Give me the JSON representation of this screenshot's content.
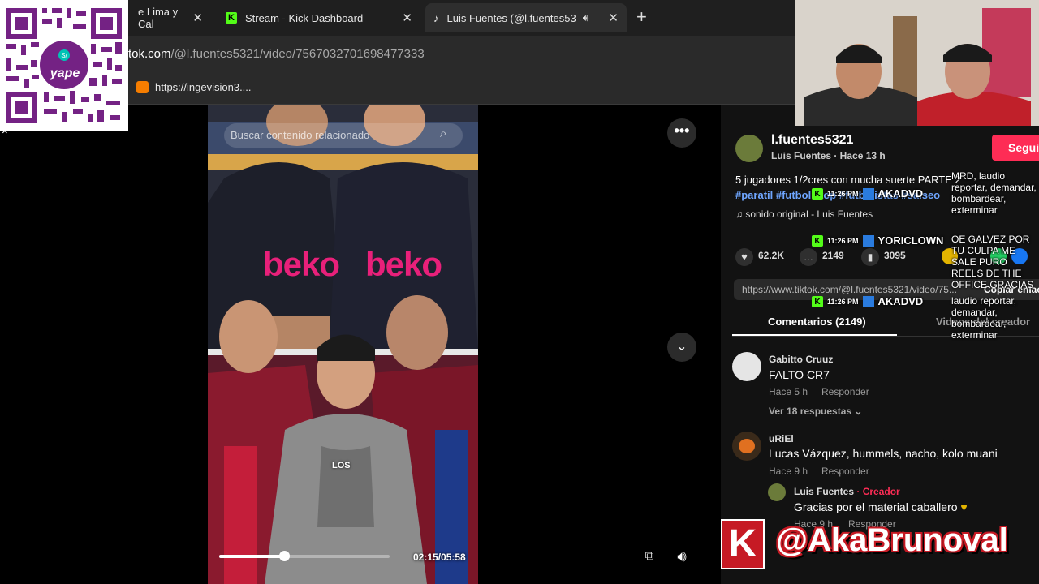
{
  "tabs": [
    {
      "title": "e Lima y Cal"
    },
    {
      "title": "Stream - Kick Dashboard"
    },
    {
      "title": "Luis Fuentes (@l.fuentes53"
    }
  ],
  "address": {
    "host": "tok.com",
    "path": "/@l.fuentes5321/video/7567032701698477333"
  },
  "bookmark": {
    "label": "https://ingevision3...."
  },
  "qr": {
    "brand": "yape"
  },
  "video": {
    "search_placeholder": "Buscar contenido relacionado",
    "caption_word": "LOS",
    "time": "02:15/05:58",
    "progress": 0.38,
    "shirt_brand": "beko"
  },
  "post": {
    "username": "l.fuentes5321",
    "meta": "Luis Fuentes · Hace 13 h",
    "follow_label": "Segui",
    "description": "5 jugadores 1/2cres con mucha suerte PARTE 2",
    "hashtags": "#paratil #futbol #top #futbolistas #salseo",
    "sound": "sonido original - Luis Fuentes",
    "likes": "62.2K",
    "comments": "2149",
    "saves": "3095",
    "url": "https://www.tiktok.com/@l.fuentes5321/video/75...",
    "copy_label": "Copiar enlac",
    "tab_comments": "Comentarios (2149)",
    "tab_videos": "Videos del creador"
  },
  "comments": [
    {
      "user": "Gabitto Cruuz",
      "text": "FALTO CR7",
      "time": "Hace 5 h",
      "reply": "Responder",
      "more": "Ver 18 respuestas"
    },
    {
      "user": "uRiEl",
      "text": "Lucas Vázquez, hummels, nacho, kolo muani",
      "time": "Hace 9 h",
      "reply": "Responder"
    },
    {
      "user": "Luis Fuentes",
      "creator": "Creador",
      "text": "Gracias por el material caballero",
      "time": "Hace 9 h",
      "reply": "Responder"
    }
  ],
  "chat": [
    {
      "time": "11:26 PM",
      "user": "AKADVD",
      "msg": "MRD, laudio reportar, demandar, bombardear, exterminar"
    },
    {
      "time": "11:26 PM",
      "user": "YORICLOWN",
      "msg": "OE GALVEZ POR TU CULPA ME SALE PURO REELS DE THE OFFICE GRACIAS"
    },
    {
      "time": "11:26 PM",
      "user": "AKADVD",
      "msg": "laudio reportar, demandar, bombardear, exterminar"
    }
  ],
  "overlay": {
    "handle": "@AkaBrunoval"
  },
  "colors": {
    "accent": "#fe2c55",
    "kick": "#53fc18",
    "yape": "#742284"
  }
}
